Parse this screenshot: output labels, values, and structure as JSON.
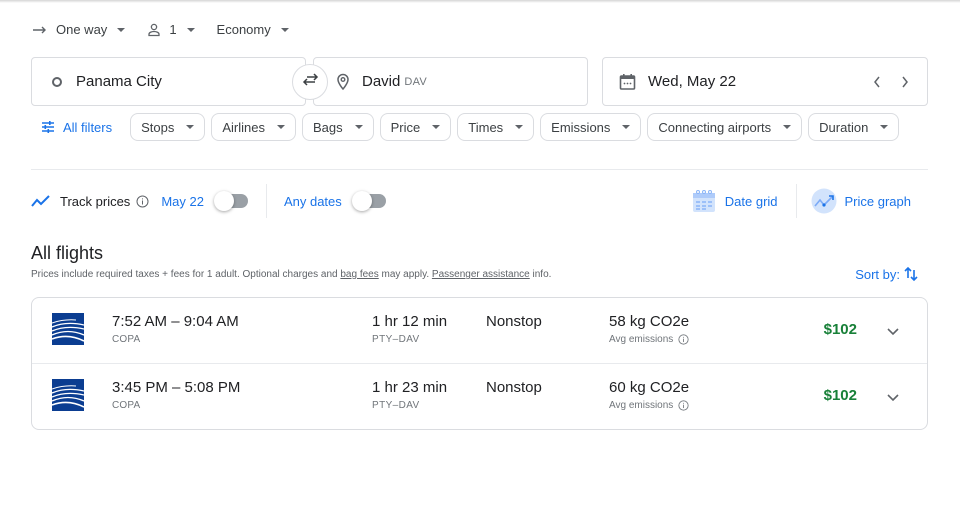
{
  "trip_options": {
    "trip_type": "One way",
    "passengers": "1",
    "cabin_class": "Economy"
  },
  "search": {
    "origin": "Panama City",
    "destination": "David",
    "destination_code": "DAV",
    "date": "Wed, May 22"
  },
  "filters": {
    "all_filters_label": "All filters",
    "chips": [
      "Stops",
      "Airlines",
      "Bags",
      "Price",
      "Times",
      "Emissions",
      "Connecting airports",
      "Duration"
    ]
  },
  "tracking": {
    "track_prices_label": "Track prices",
    "track_date_label": "May 22",
    "track_date_toggle_on": false,
    "any_dates_label": "Any dates",
    "any_dates_toggle_on": false,
    "date_grid_label": "Date grid",
    "price_graph_label": "Price graph"
  },
  "results": {
    "heading": "All flights",
    "note_prefix": "Prices include required taxes + fees for 1 adult. Optional charges and ",
    "note_link1": "bag fees",
    "note_middle": " may apply. ",
    "note_link2": "Passenger assistance",
    "note_suffix": " info.",
    "sort_label": "Sort by:",
    "flights": [
      {
        "times": "7:52 AM – 9:04 AM",
        "airline": "COPA",
        "duration": "1 hr 12 min",
        "route": "PTY–DAV",
        "stops": "Nonstop",
        "emissions": "58 kg CO2e",
        "emissions_note": "Avg emissions",
        "price": "$102"
      },
      {
        "times": "3:45 PM – 5:08 PM",
        "airline": "COPA",
        "duration": "1 hr 23 min",
        "route": "PTY–DAV",
        "stops": "Nonstop",
        "emissions": "60 kg CO2e",
        "emissions_note": "Avg emissions",
        "price": "$102"
      }
    ]
  },
  "colors": {
    "accent": "#1a73e8",
    "price": "#188038",
    "airline_logo": "#0b3d91"
  }
}
